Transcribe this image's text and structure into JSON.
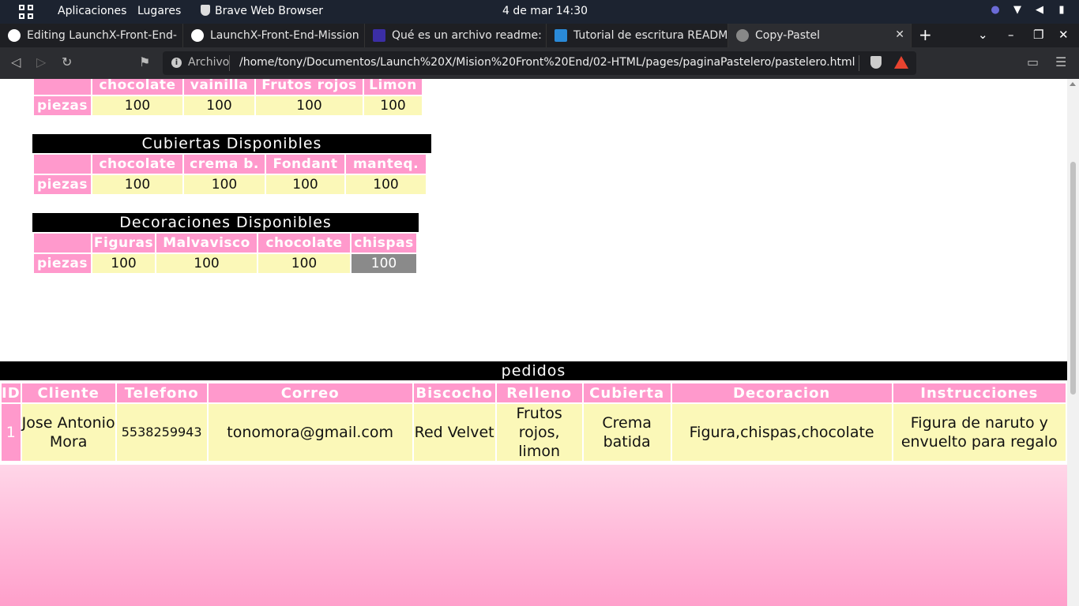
{
  "desktop": {
    "apps_label": "Aplicaciones",
    "places_label": "Lugares",
    "active_app": "Brave Web Browser",
    "clock": "4 de mar  14:30"
  },
  "tabs": [
    {
      "label": "Editing LaunchX-Front-End-",
      "icon": "github-icon"
    },
    {
      "label": "LaunchX-Front-End-Mission",
      "icon": "github-icon"
    },
    {
      "label": "Qué es un archivo readme: ex",
      "icon": "page-icon"
    },
    {
      "label": "Tutorial de escritura READMI",
      "icon": "pycharm-icon"
    },
    {
      "label": "Copy-Pastel",
      "icon": "globe-icon"
    }
  ],
  "address": {
    "scheme": "Archivo",
    "url": "/home/tony/Documentos/Launch%20X/Mision%20Front%20End/02-HTML/pages/paginaPastelero/pastelero.html"
  },
  "rellenos": {
    "headers": [
      "",
      "chocolate",
      "vainilla",
      "Frutos rojos",
      "Limon"
    ],
    "row_label": "piezas",
    "values": [
      "100",
      "100",
      "100",
      "100"
    ]
  },
  "cubiertas": {
    "title": "Cubiertas Disponibles",
    "headers": [
      "",
      "chocolate",
      "crema b.",
      "Fondant",
      "manteq."
    ],
    "row_label": "piezas",
    "values": [
      "100",
      "100",
      "100",
      "100"
    ]
  },
  "decoraciones": {
    "title": "Decoraciones Disponibles",
    "headers": [
      "",
      "Figuras",
      "Malvavisco",
      "chocolate",
      "chispas"
    ],
    "row_label": "piezas",
    "values": [
      "100",
      "100",
      "100",
      "100"
    ]
  },
  "pedidos": {
    "title": "pedidos",
    "headers": [
      "ID",
      "Cliente",
      "Telefono",
      "Correo",
      "Biscocho",
      "Relleno",
      "Cubierta",
      "Decoracion",
      "Instrucciones"
    ],
    "rows": [
      [
        "1",
        "Jose Antonio Mora",
        "5538259943",
        "tonomora@gmail.com",
        "Red Velvet",
        "Frutos rojos, limon",
        "Crema batida",
        "Figura,chispas,chocolate",
        "Figura de naruto y envuelto para regalo"
      ]
    ]
  },
  "colors": {
    "header_pink": "#ff99cc",
    "cell_yellow": "#fbf8b8",
    "caption_black": "#000000"
  }
}
